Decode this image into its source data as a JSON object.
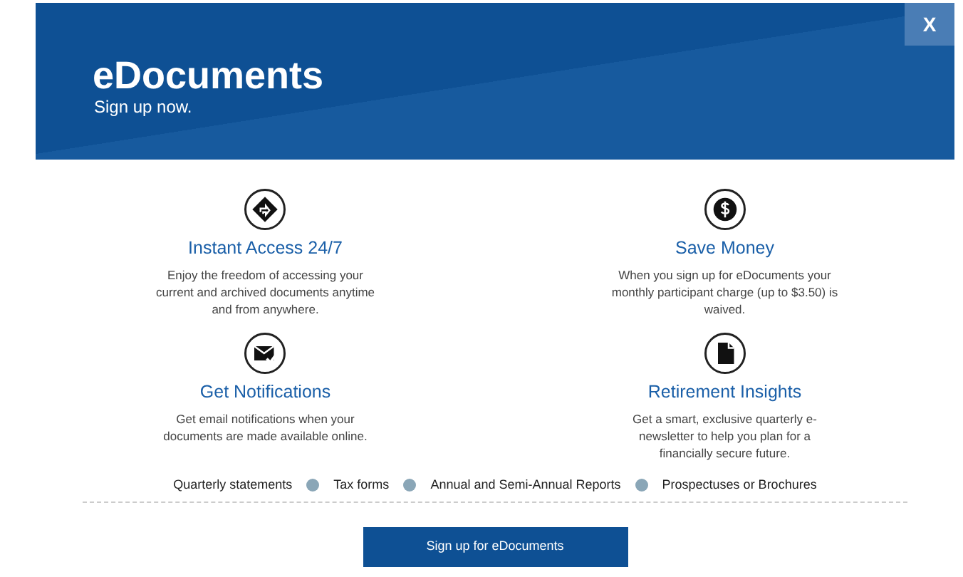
{
  "header": {
    "title": "eDocuments",
    "subtitle": "Sign up now.",
    "close": "X"
  },
  "features": [
    {
      "title": "Instant Access 24/7",
      "text": "Enjoy the freedom of accessing your current and archived documents anytime and from anywhere."
    },
    {
      "title": "Save Money",
      "text": "When you sign up for eDocuments your monthly participant charge (up to $3.50) is waived."
    },
    {
      "title": "Get Notifications",
      "text": "Get email notifications when your documents are made available online."
    },
    {
      "title": "Retirement Insights",
      "text": "Get a smart, exclusive quarterly e-newsletter to help you plan for a financially secure future."
    }
  ],
  "document_types": [
    "Quarterly statements",
    "Tax forms",
    "Annual and Semi-Annual Reports",
    "Prospectuses or Brochures"
  ],
  "signup_button": "Sign up for eDocuments"
}
